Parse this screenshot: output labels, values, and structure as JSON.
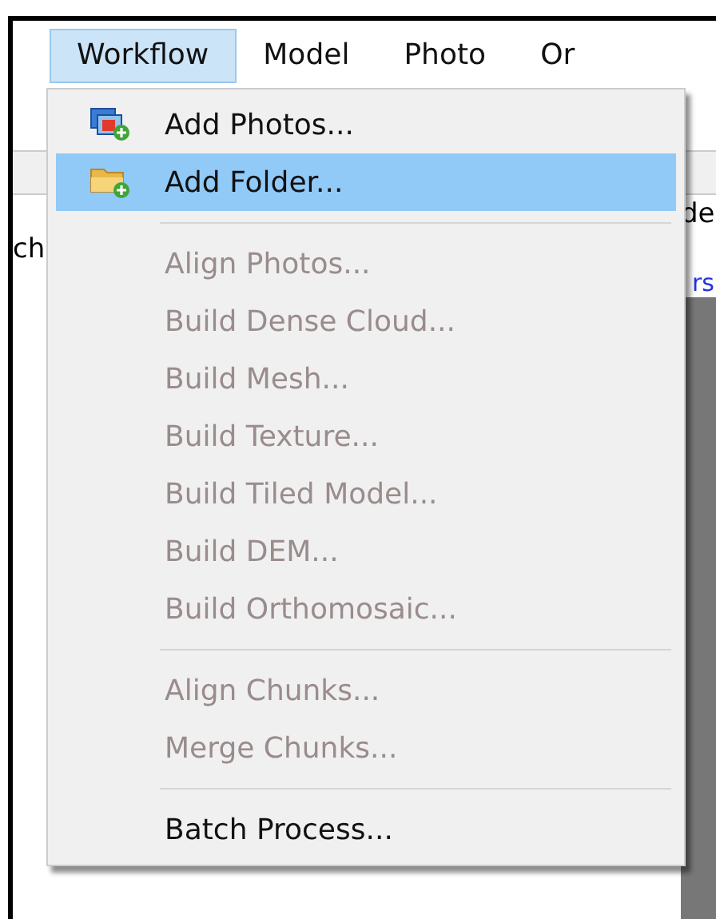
{
  "menu_bar": [
    {
      "label": "Workflow",
      "selected": true
    },
    {
      "label": "Model",
      "selected": false
    },
    {
      "label": "Photo",
      "selected": false
    },
    {
      "label": "Or",
      "selected": false
    }
  ],
  "background_fragments": {
    "text_1": "ch",
    "text_2": "de",
    "link_text": "rs"
  },
  "menu": {
    "items": [
      {
        "kind": "item",
        "label": "Add Photos...",
        "disabled": false,
        "selected": false
      },
      {
        "kind": "item",
        "label": "Add Folder...",
        "disabled": false,
        "selected": true
      },
      {
        "kind": "separator"
      },
      {
        "kind": "item",
        "label": "Align Photos...",
        "disabled": true,
        "selected": false
      },
      {
        "kind": "item",
        "label": "Build Dense Cloud...",
        "disabled": true,
        "selected": false
      },
      {
        "kind": "item",
        "label": "Build Mesh...",
        "disabled": true,
        "selected": false
      },
      {
        "kind": "item",
        "label": "Build Texture...",
        "disabled": true,
        "selected": false
      },
      {
        "kind": "item",
        "label": "Build Tiled Model...",
        "disabled": true,
        "selected": false
      },
      {
        "kind": "item",
        "label": "Build DEM...",
        "disabled": true,
        "selected": false
      },
      {
        "kind": "item",
        "label": "Build Orthomosaic...",
        "disabled": true,
        "selected": false
      },
      {
        "kind": "separator"
      },
      {
        "kind": "item",
        "label": "Align Chunks...",
        "disabled": true,
        "selected": false
      },
      {
        "kind": "item",
        "label": "Merge Chunks...",
        "disabled": true,
        "selected": false
      },
      {
        "kind": "separator"
      },
      {
        "kind": "item",
        "label": "Batch Process...",
        "disabled": false,
        "selected": false
      }
    ]
  }
}
